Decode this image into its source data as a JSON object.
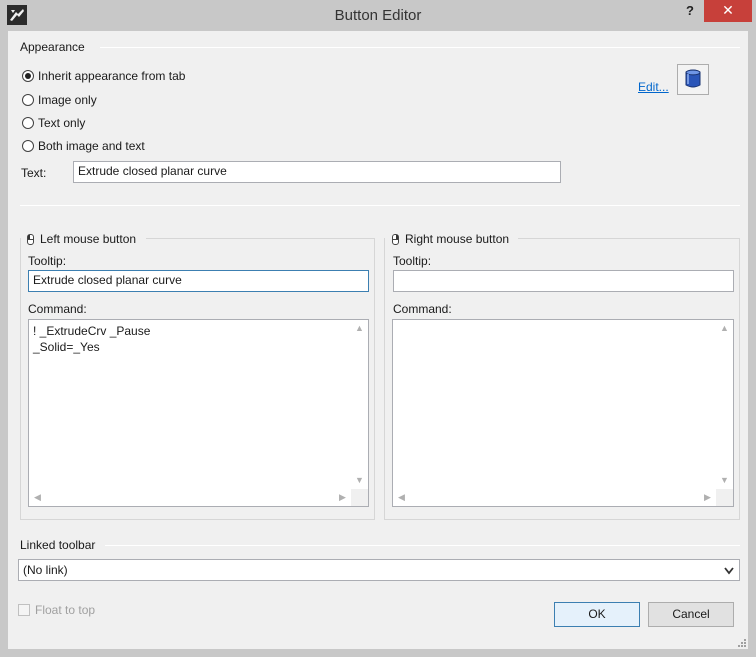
{
  "window": {
    "title": "Button Editor",
    "help_label": "?",
    "close_label": "✕"
  },
  "appearance": {
    "section_label": "Appearance",
    "options": [
      {
        "label": "Inherit appearance from tab",
        "checked": true
      },
      {
        "label": "Image only",
        "checked": false
      },
      {
        "label": "Text only",
        "checked": false
      },
      {
        "label": "Both image and text",
        "checked": false
      }
    ],
    "text_label": "Text:",
    "text_value": "Extrude closed planar curve",
    "edit_link": "Edit..."
  },
  "left_mouse": {
    "title": "Left mouse button",
    "tooltip_label": "Tooltip:",
    "tooltip_value": "Extrude closed planar curve",
    "command_label": "Command:",
    "command_value": "! _ExtrudeCrv _Pause\n_Solid=_Yes"
  },
  "right_mouse": {
    "title": "Right mouse button",
    "tooltip_label": "Tooltip:",
    "tooltip_value": "",
    "command_label": "Command:",
    "command_value": ""
  },
  "linked_toolbar": {
    "section_label": "Linked toolbar",
    "selected": "(No link)"
  },
  "footer": {
    "float_to_top_label": "Float to top",
    "ok_label": "OK",
    "cancel_label": "Cancel"
  },
  "colors": {
    "title_bar": "#c8c8c8",
    "close_button": "#c7403a",
    "link": "#0066cc",
    "focus_border": "#3c7fb1"
  },
  "icons": [
    "rhino-app-icon",
    "mouse-left-icon",
    "mouse-right-icon",
    "cylinder-icon",
    "chevron-down-icon",
    "size-grip-icon"
  ]
}
